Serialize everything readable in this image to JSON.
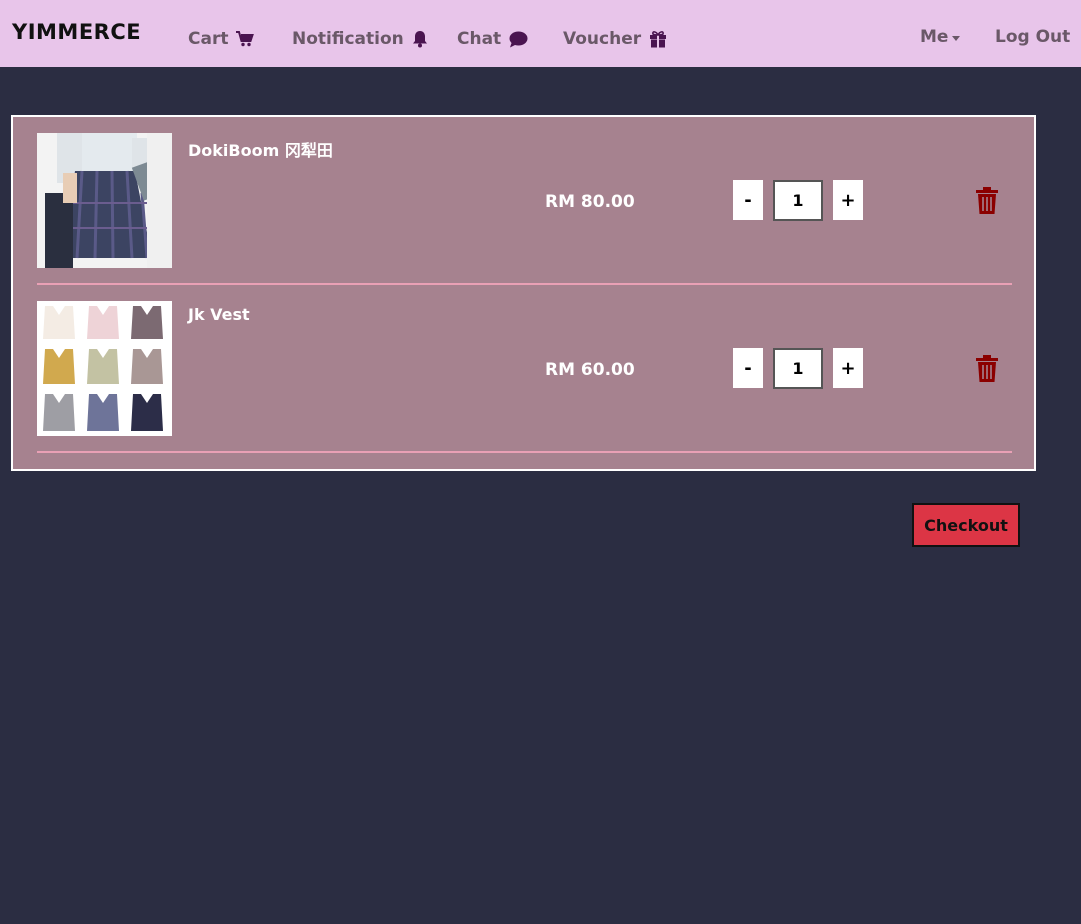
{
  "navbar": {
    "brand": "YIMMERCE",
    "links": [
      {
        "label": "Cart",
        "icon": "cart-icon"
      },
      {
        "label": "Notification",
        "icon": "bell-icon"
      },
      {
        "label": "Chat",
        "icon": "chat-bubble-icon"
      },
      {
        "label": "Voucher",
        "icon": "gift-icon"
      }
    ],
    "me_label": "Me",
    "logout_label": "Log Out"
  },
  "cart": {
    "items": [
      {
        "name": "DokiBoom 冈犁田",
        "price": "RM 80.00",
        "quantity": "1",
        "minus_label": "-",
        "plus_label": "+",
        "image": "plaid-skirt-photo"
      },
      {
        "name": "Jk Vest",
        "price": "RM 60.00",
        "quantity": "1",
        "minus_label": "-",
        "plus_label": "+",
        "image": "vest-grid-photo"
      }
    ]
  },
  "checkout_label": "Checkout",
  "colors": {
    "navbar_bg": "#e8c5ea",
    "page_bg": "#2b2d42",
    "panel_bg": "#a6828f",
    "divider": "#e9a0b5",
    "checkout_bg": "#dc3545",
    "trash": "#8b0000",
    "nav_icon": "#4a1450"
  }
}
